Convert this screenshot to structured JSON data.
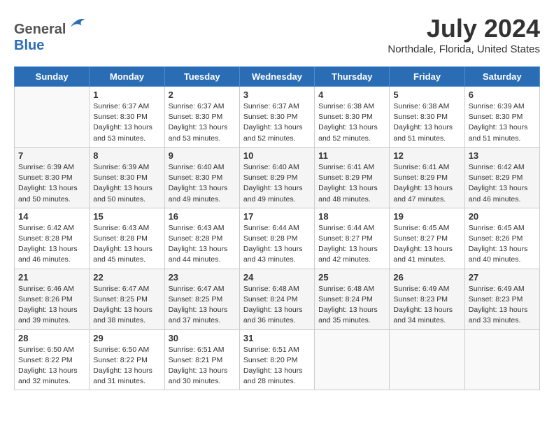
{
  "logo": {
    "text_general": "General",
    "text_blue": "Blue"
  },
  "title": "July 2024",
  "subtitle": "Northdale, Florida, United States",
  "days_of_week": [
    "Sunday",
    "Monday",
    "Tuesday",
    "Wednesday",
    "Thursday",
    "Friday",
    "Saturday"
  ],
  "weeks": [
    [
      {
        "day": "",
        "sunrise": "",
        "sunset": "",
        "daylight": ""
      },
      {
        "day": "1",
        "sunrise": "Sunrise: 6:37 AM",
        "sunset": "Sunset: 8:30 PM",
        "daylight": "Daylight: 13 hours and 53 minutes."
      },
      {
        "day": "2",
        "sunrise": "Sunrise: 6:37 AM",
        "sunset": "Sunset: 8:30 PM",
        "daylight": "Daylight: 13 hours and 53 minutes."
      },
      {
        "day": "3",
        "sunrise": "Sunrise: 6:37 AM",
        "sunset": "Sunset: 8:30 PM",
        "daylight": "Daylight: 13 hours and 52 minutes."
      },
      {
        "day": "4",
        "sunrise": "Sunrise: 6:38 AM",
        "sunset": "Sunset: 8:30 PM",
        "daylight": "Daylight: 13 hours and 52 minutes."
      },
      {
        "day": "5",
        "sunrise": "Sunrise: 6:38 AM",
        "sunset": "Sunset: 8:30 PM",
        "daylight": "Daylight: 13 hours and 51 minutes."
      },
      {
        "day": "6",
        "sunrise": "Sunrise: 6:39 AM",
        "sunset": "Sunset: 8:30 PM",
        "daylight": "Daylight: 13 hours and 51 minutes."
      }
    ],
    [
      {
        "day": "7",
        "sunrise": "Sunrise: 6:39 AM",
        "sunset": "Sunset: 8:30 PM",
        "daylight": "Daylight: 13 hours and 50 minutes."
      },
      {
        "day": "8",
        "sunrise": "Sunrise: 6:39 AM",
        "sunset": "Sunset: 8:30 PM",
        "daylight": "Daylight: 13 hours and 50 minutes."
      },
      {
        "day": "9",
        "sunrise": "Sunrise: 6:40 AM",
        "sunset": "Sunset: 8:30 PM",
        "daylight": "Daylight: 13 hours and 49 minutes."
      },
      {
        "day": "10",
        "sunrise": "Sunrise: 6:40 AM",
        "sunset": "Sunset: 8:29 PM",
        "daylight": "Daylight: 13 hours and 49 minutes."
      },
      {
        "day": "11",
        "sunrise": "Sunrise: 6:41 AM",
        "sunset": "Sunset: 8:29 PM",
        "daylight": "Daylight: 13 hours and 48 minutes."
      },
      {
        "day": "12",
        "sunrise": "Sunrise: 6:41 AM",
        "sunset": "Sunset: 8:29 PM",
        "daylight": "Daylight: 13 hours and 47 minutes."
      },
      {
        "day": "13",
        "sunrise": "Sunrise: 6:42 AM",
        "sunset": "Sunset: 8:29 PM",
        "daylight": "Daylight: 13 hours and 46 minutes."
      }
    ],
    [
      {
        "day": "14",
        "sunrise": "Sunrise: 6:42 AM",
        "sunset": "Sunset: 8:28 PM",
        "daylight": "Daylight: 13 hours and 46 minutes."
      },
      {
        "day": "15",
        "sunrise": "Sunrise: 6:43 AM",
        "sunset": "Sunset: 8:28 PM",
        "daylight": "Daylight: 13 hours and 45 minutes."
      },
      {
        "day": "16",
        "sunrise": "Sunrise: 6:43 AM",
        "sunset": "Sunset: 8:28 PM",
        "daylight": "Daylight: 13 hours and 44 minutes."
      },
      {
        "day": "17",
        "sunrise": "Sunrise: 6:44 AM",
        "sunset": "Sunset: 8:28 PM",
        "daylight": "Daylight: 13 hours and 43 minutes."
      },
      {
        "day": "18",
        "sunrise": "Sunrise: 6:44 AM",
        "sunset": "Sunset: 8:27 PM",
        "daylight": "Daylight: 13 hours and 42 minutes."
      },
      {
        "day": "19",
        "sunrise": "Sunrise: 6:45 AM",
        "sunset": "Sunset: 8:27 PM",
        "daylight": "Daylight: 13 hours and 41 minutes."
      },
      {
        "day": "20",
        "sunrise": "Sunrise: 6:45 AM",
        "sunset": "Sunset: 8:26 PM",
        "daylight": "Daylight: 13 hours and 40 minutes."
      }
    ],
    [
      {
        "day": "21",
        "sunrise": "Sunrise: 6:46 AM",
        "sunset": "Sunset: 8:26 PM",
        "daylight": "Daylight: 13 hours and 39 minutes."
      },
      {
        "day": "22",
        "sunrise": "Sunrise: 6:47 AM",
        "sunset": "Sunset: 8:25 PM",
        "daylight": "Daylight: 13 hours and 38 minutes."
      },
      {
        "day": "23",
        "sunrise": "Sunrise: 6:47 AM",
        "sunset": "Sunset: 8:25 PM",
        "daylight": "Daylight: 13 hours and 37 minutes."
      },
      {
        "day": "24",
        "sunrise": "Sunrise: 6:48 AM",
        "sunset": "Sunset: 8:24 PM",
        "daylight": "Daylight: 13 hours and 36 minutes."
      },
      {
        "day": "25",
        "sunrise": "Sunrise: 6:48 AM",
        "sunset": "Sunset: 8:24 PM",
        "daylight": "Daylight: 13 hours and 35 minutes."
      },
      {
        "day": "26",
        "sunrise": "Sunrise: 6:49 AM",
        "sunset": "Sunset: 8:23 PM",
        "daylight": "Daylight: 13 hours and 34 minutes."
      },
      {
        "day": "27",
        "sunrise": "Sunrise: 6:49 AM",
        "sunset": "Sunset: 8:23 PM",
        "daylight": "Daylight: 13 hours and 33 minutes."
      }
    ],
    [
      {
        "day": "28",
        "sunrise": "Sunrise: 6:50 AM",
        "sunset": "Sunset: 8:22 PM",
        "daylight": "Daylight: 13 hours and 32 minutes."
      },
      {
        "day": "29",
        "sunrise": "Sunrise: 6:50 AM",
        "sunset": "Sunset: 8:22 PM",
        "daylight": "Daylight: 13 hours and 31 minutes."
      },
      {
        "day": "30",
        "sunrise": "Sunrise: 6:51 AM",
        "sunset": "Sunset: 8:21 PM",
        "daylight": "Daylight: 13 hours and 30 minutes."
      },
      {
        "day": "31",
        "sunrise": "Sunrise: 6:51 AM",
        "sunset": "Sunset: 8:20 PM",
        "daylight": "Daylight: 13 hours and 28 minutes."
      },
      {
        "day": "",
        "sunrise": "",
        "sunset": "",
        "daylight": ""
      },
      {
        "day": "",
        "sunrise": "",
        "sunset": "",
        "daylight": ""
      },
      {
        "day": "",
        "sunrise": "",
        "sunset": "",
        "daylight": ""
      }
    ]
  ]
}
